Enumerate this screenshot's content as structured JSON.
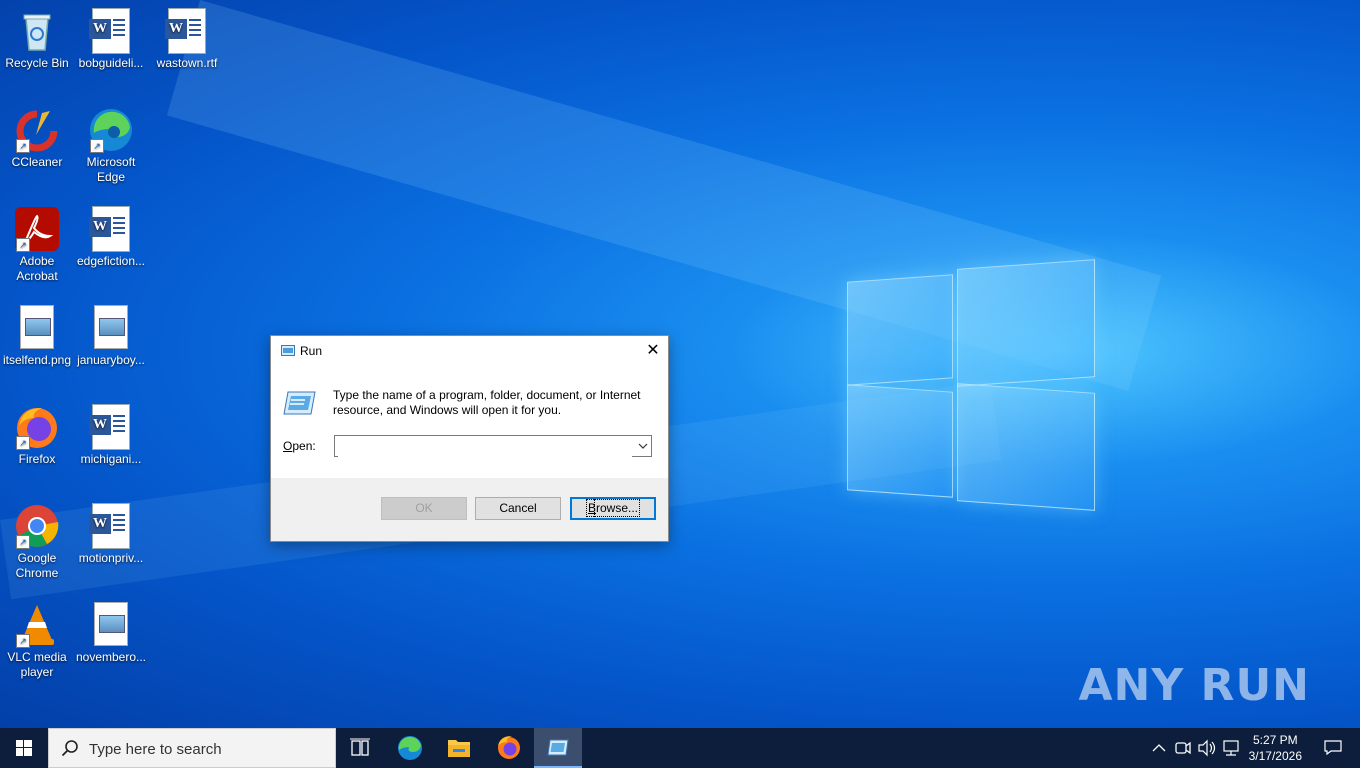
{
  "desktop": {
    "icons": [
      {
        "label": "Recycle Bin"
      },
      {
        "label": "bobguideli..."
      },
      {
        "label": "wastown.rtf"
      },
      {
        "label": "CCleaner"
      },
      {
        "label": "Microsoft Edge"
      },
      {
        "label": "Adobe Acrobat"
      },
      {
        "label": "edgefiction..."
      },
      {
        "label": "itselfend.png"
      },
      {
        "label": "januaryboy..."
      },
      {
        "label": "Firefox"
      },
      {
        "label": "michigani..."
      },
      {
        "label": "Google Chrome"
      },
      {
        "label": "motionpriv..."
      },
      {
        "label": "VLC media player"
      },
      {
        "label": "novembero..."
      }
    ]
  },
  "run_dialog": {
    "title": "Run",
    "description": "Type the name of a program, folder, document, or Internet resource, and Windows will open it for you.",
    "open_label_mnemonic": "O",
    "open_label_rest": "pen:",
    "input_value": "",
    "ok_label": "OK",
    "cancel_label": "Cancel",
    "browse_label_mnemonic": "B",
    "browse_label_rest": "rowse..."
  },
  "watermark": "ANY RUN",
  "taskbar": {
    "search_placeholder": "Type here to search",
    "time": "5:27 PM",
    "date": "3/17/2026"
  },
  "colors": {
    "accent": "#0078d7",
    "taskbar": "#0c1e3b"
  }
}
